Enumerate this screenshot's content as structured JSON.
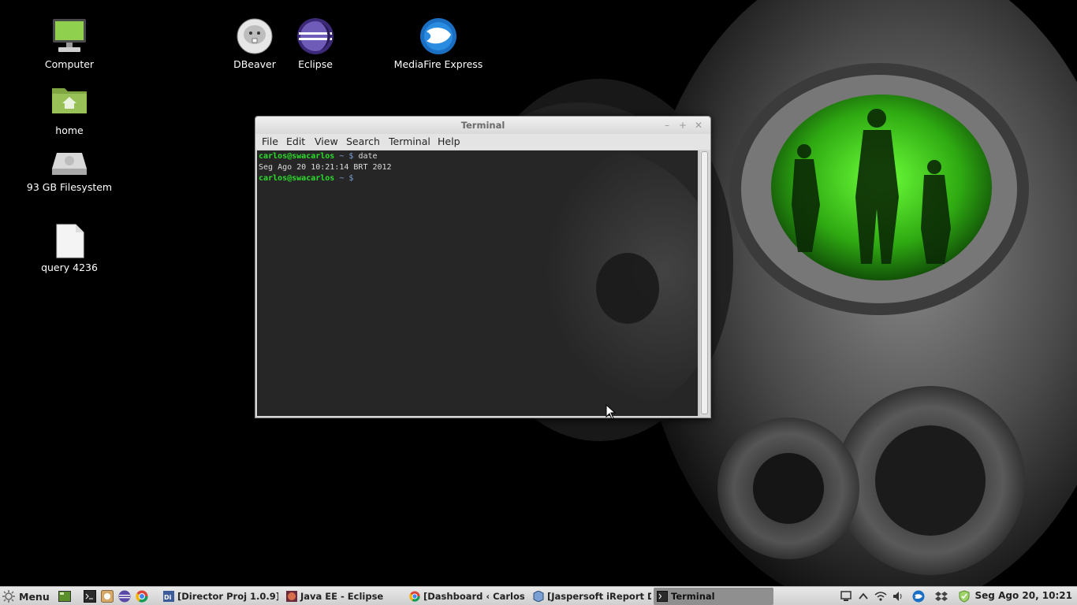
{
  "desktop": {
    "icons": [
      {
        "label": "Computer",
        "icon": "computer-icon"
      },
      {
        "label": "home",
        "icon": "home-folder-icon"
      },
      {
        "label": "93 GB Filesystem",
        "icon": "drive-icon"
      },
      {
        "label": "query 4236",
        "icon": "file-icon"
      },
      {
        "label": "DBeaver",
        "icon": "dbeaver-icon"
      },
      {
        "label": "Eclipse",
        "icon": "eclipse-icon"
      },
      {
        "label": "MediaFire Express",
        "icon": "mediafire-icon"
      }
    ]
  },
  "terminal": {
    "title": "Terminal",
    "menu": [
      "File",
      "Edit",
      "View",
      "Search",
      "Terminal",
      "Help"
    ],
    "lines": [
      {
        "user": "carlos@swacarlos",
        "rest": " ~ $ ",
        "cmd": "date"
      },
      {
        "output": "Seg Ago 20 10:21:14 BRT 2012"
      },
      {
        "user": "carlos@swacarlos",
        "rest": " ~ $ ",
        "cmd": ""
      }
    ],
    "colors": {
      "prompt_user": "#2adf2a",
      "prompt_path": "#7b9fd6",
      "background": "#262626"
    }
  },
  "taskbar": {
    "menu_label": "Menu",
    "launchers": [
      "show-desktop-icon",
      "terminal-icon",
      "file-manager-icon",
      "eclipse-icon",
      "chrome-icon"
    ],
    "tasks": [
      {
        "label": "[Director Proj 1.0.9]",
        "icon": "director-icon",
        "active": false
      },
      {
        "label": "Java EE - Eclipse",
        "icon": "eclipse-icon",
        "active": false
      },
      {
        "label": "[Dashboard ‹ Carlos ...",
        "icon": "chrome-icon",
        "active": false
      },
      {
        "label": "[Jaspersoft iReport D...",
        "icon": "ireport-icon",
        "active": false
      },
      {
        "label": "Terminal",
        "icon": "terminal-icon",
        "active": true
      }
    ],
    "tray": [
      "network-icon",
      "chevron-up-icon",
      "wifi-icon",
      "volume-icon",
      "mediafire-tray-icon",
      "dropbox-icon",
      "update-shield-icon"
    ],
    "clock": "Seg Ago 20, 10:21"
  }
}
